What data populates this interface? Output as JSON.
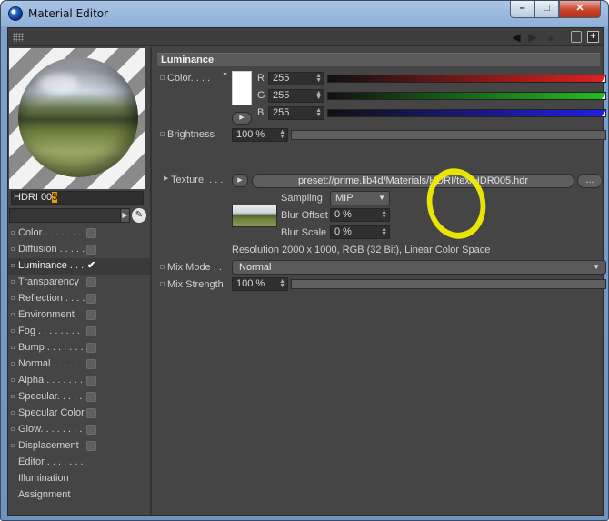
{
  "window": {
    "title": "Material Editor",
    "min_glyph": "–",
    "max_glyph": "□",
    "close_glyph": "✕"
  },
  "toolbar": {
    "icons": [
      "grip-icon",
      "back-arrow-icon",
      "forward-arrow-icon",
      "up-arrow-icon",
      "lock-icon",
      "new-window-icon"
    ],
    "back_glyph": "◀",
    "fwd_glyph": "▶",
    "up_glyph": "▲",
    "newwin_glyph": "+"
  },
  "material": {
    "name_plain": "HDRI 00",
    "name_selected": "5",
    "pick_glyph": "✎"
  },
  "channels": [
    {
      "label": "Color . . . . . . .",
      "checkbox": true,
      "checked": false
    },
    {
      "label": "Diffusion . . . . .",
      "checkbox": true,
      "checked": false
    },
    {
      "label": "Luminance . . .",
      "checkbox": true,
      "checked": true
    },
    {
      "label": "Transparency",
      "checkbox": true,
      "checked": false
    },
    {
      "label": "Reflection . . . .",
      "checkbox": true,
      "checked": false
    },
    {
      "label": "Environment",
      "checkbox": true,
      "checked": false
    },
    {
      "label": "Fog . . . . . . . .",
      "checkbox": true,
      "checked": false
    },
    {
      "label": "Bump . . . . . . .",
      "checkbox": true,
      "checked": false
    },
    {
      "label": "Normal . . . . . .",
      "checkbox": true,
      "checked": false
    },
    {
      "label": "Alpha . . . . . . .",
      "checkbox": true,
      "checked": false
    },
    {
      "label": "Specular. . . . .",
      "checkbox": true,
      "checked": false
    },
    {
      "label": "Specular Color",
      "checkbox": true,
      "checked": false
    },
    {
      "label": "Glow. . . . . . . .",
      "checkbox": true,
      "checked": false
    },
    {
      "label": "Displacement",
      "checkbox": true,
      "checked": false
    },
    {
      "label": "Editor . . . . . . .",
      "checkbox": false,
      "checked": false
    },
    {
      "label": "Illumination",
      "checkbox": false,
      "checked": false
    },
    {
      "label": "Assignment",
      "checkbox": false,
      "checked": false
    }
  ],
  "luminance": {
    "section_title": "Luminance",
    "color_label": "Color. . . .",
    "color_value": "#ffffff",
    "r_letter": "R",
    "g_letter": "G",
    "b_letter": "B",
    "r": "255",
    "g": "255",
    "b": "255",
    "r_bar_color": "#e02020",
    "g_bar_color": "#20c020",
    "b_bar_color": "#2020e0",
    "brightness_label": "Brightness",
    "brightness": "100 %",
    "brightness_fraction": 1.0,
    "texture_label": "Texture. . . .",
    "texture_path": "preset://prime.lib4d/Materials/HDRI/tex/HDR005.hdr",
    "texture_more": "...",
    "sampling_label": "Sampling",
    "sampling_value": "MIP",
    "blur_offset_label": "Blur Offset",
    "blur_offset": "0 %",
    "blur_scale_label": "Blur Scale",
    "blur_scale": "0 %",
    "resolution_text": "Resolution 2000 x 1000, RGB (32 Bit), Linear Color Space",
    "mix_mode_label": "Mix Mode . .",
    "mix_mode": "Normal",
    "mix_strength_label": "Mix Strength",
    "mix_strength": "100 %",
    "mix_strength_fraction": 1.0
  },
  "colors": {
    "panel_bg": "#454545",
    "accent_orange": "#e8a000",
    "annotation_yellow": "#f1ee00"
  }
}
